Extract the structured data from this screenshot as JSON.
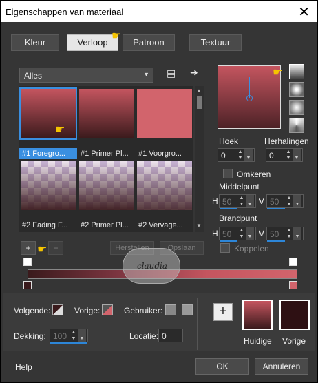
{
  "window": {
    "title": "Eigenschappen van materiaal",
    "close": "✕"
  },
  "tabs": [
    {
      "label": "Kleur"
    },
    {
      "label": "Verloop"
    },
    {
      "label": "Patroon"
    },
    {
      "label": "Textuur"
    }
  ],
  "filter": {
    "value": "Alles"
  },
  "gallery": {
    "items": [
      {
        "label": "#1 Foregro...",
        "selected": true
      },
      {
        "label": "#1 Primer Pl..."
      },
      {
        "label": "#1 Voorgro..."
      },
      {
        "label": "#2 Fading F..."
      },
      {
        "label": "#2 Primer Pl..."
      },
      {
        "label": "#2 Vervage..."
      }
    ]
  },
  "gallery_buttons": {
    "add": "+",
    "minus": "−",
    "restore": "Herstellen",
    "save": "Opslaan"
  },
  "settings": {
    "angle_label": "Hoek",
    "angle_value": "0",
    "repeat_label": "Herhalingen",
    "repeat_value": "0",
    "invert_label": "Omkeren",
    "midpoint_label": "Middelpunt",
    "mid_h_label": "H",
    "mid_h_value": "50",
    "mid_v_label": "V",
    "mid_v_value": "50",
    "focus_label": "Brandpunt",
    "focus_h_label": "H",
    "focus_h_value": "50",
    "focus_v_label": "V",
    "focus_v_value": "50",
    "link_label": "Koppelen"
  },
  "watermark": {
    "text": "claudia"
  },
  "bottom": {
    "next_label": "Volgende:",
    "prev_label": "Vorige:",
    "user_label": "Gebruiker:",
    "opacity_label": "Dekking:",
    "opacity_value": "100",
    "location_label": "Locatie:",
    "location_value": "0",
    "plus": "+",
    "current_label": "Huidige",
    "previous_label": "Vorige"
  },
  "footer": {
    "help": "Help",
    "ok": "OK",
    "cancel": "Annuleren"
  },
  "colors": {
    "accent": "#3a8fe0",
    "gradient_light": "#d2646c",
    "gradient_dark": "#3a1a1c"
  }
}
